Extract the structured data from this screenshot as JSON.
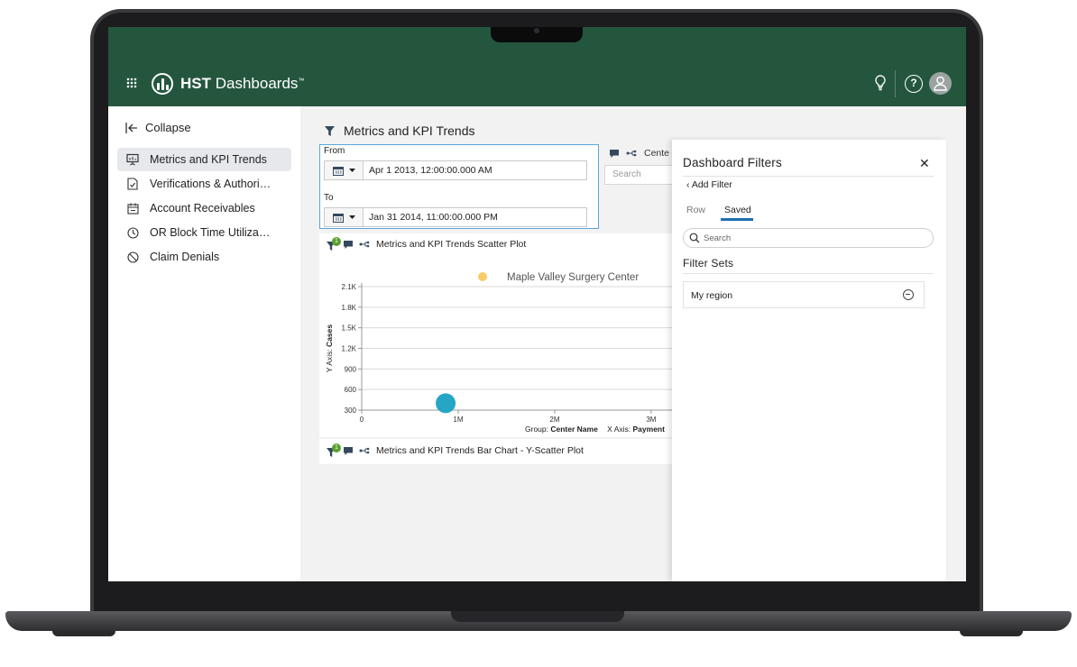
{
  "app": {
    "brand_prefix": "HST",
    "brand_name": "Dashboards",
    "brand_tm": "™"
  },
  "sidebar": {
    "collapse_label": "Collapse",
    "items": [
      {
        "label": "Metrics and KPI Trends",
        "icon": "presentation-icon",
        "active": true
      },
      {
        "label": "Verifications & Authori…",
        "icon": "document-check-icon",
        "active": false
      },
      {
        "label": "Account Receivables",
        "icon": "calendar-icon",
        "active": false
      },
      {
        "label": "OR Block Time Utiliza…",
        "icon": "clock-icon",
        "active": false
      },
      {
        "label": "Claim Denials",
        "icon": "block-icon",
        "active": false
      }
    ]
  },
  "main": {
    "title": "Metrics and KPI Trends",
    "date_range": {
      "from_label": "From",
      "from_value": "Apr 1 2013, 12:00:00.000 AM",
      "to_label": "To",
      "to_value": "Jan 31 2014, 11:00:00.000 PM"
    },
    "center_label": "Cente",
    "search_placeholder": "Search",
    "scatter_card": {
      "title": "Metrics and KPI Trends Scatter Plot",
      "filter_count": "1"
    },
    "bar_card": {
      "title": "Metrics and KPI Trends Bar Chart - Y-Scatter Plot",
      "filter_count": "1"
    }
  },
  "chart_data": {
    "type": "scatter",
    "legend": {
      "label": "Maple Valley Surgery Center",
      "color": "#f9cc6b",
      "placement": "top"
    },
    "series": [
      {
        "name": "Maple Valley Surgery Center",
        "color": "#26a6c4",
        "points": [
          {
            "x": 870000,
            "y": 400
          }
        ]
      }
    ],
    "y_ticks": [
      "300",
      "600",
      "900",
      "1.2K",
      "1.5K",
      "1.8K",
      "2.1K"
    ],
    "y_tick_values": [
      300,
      600,
      900,
      1200,
      1500,
      1800,
      2100
    ],
    "x_ticks": [
      "0",
      "1M",
      "2M",
      "3M"
    ],
    "x_tick_values": [
      0,
      1000000,
      2000000,
      3000000
    ],
    "ylim": [
      300,
      2100
    ],
    "xlim": [
      0,
      3300000
    ],
    "ylabel_prefix": "Y Axis: ",
    "ylabel": "Cases",
    "group_prefix": "Group: ",
    "group": "Center Name",
    "xlabel_prefix": "X Axis: ",
    "xlabel": "Payment",
    "grid": true
  },
  "filters": {
    "title": "Dashboard Filters",
    "add_filter": "Add Filter",
    "tabs": [
      {
        "label": "Row",
        "active": false
      },
      {
        "label": "Saved",
        "active": true
      }
    ],
    "search_placeholder": "Search",
    "sets_heading": "Filter Sets",
    "sets": [
      {
        "label": "My region"
      }
    ]
  }
}
